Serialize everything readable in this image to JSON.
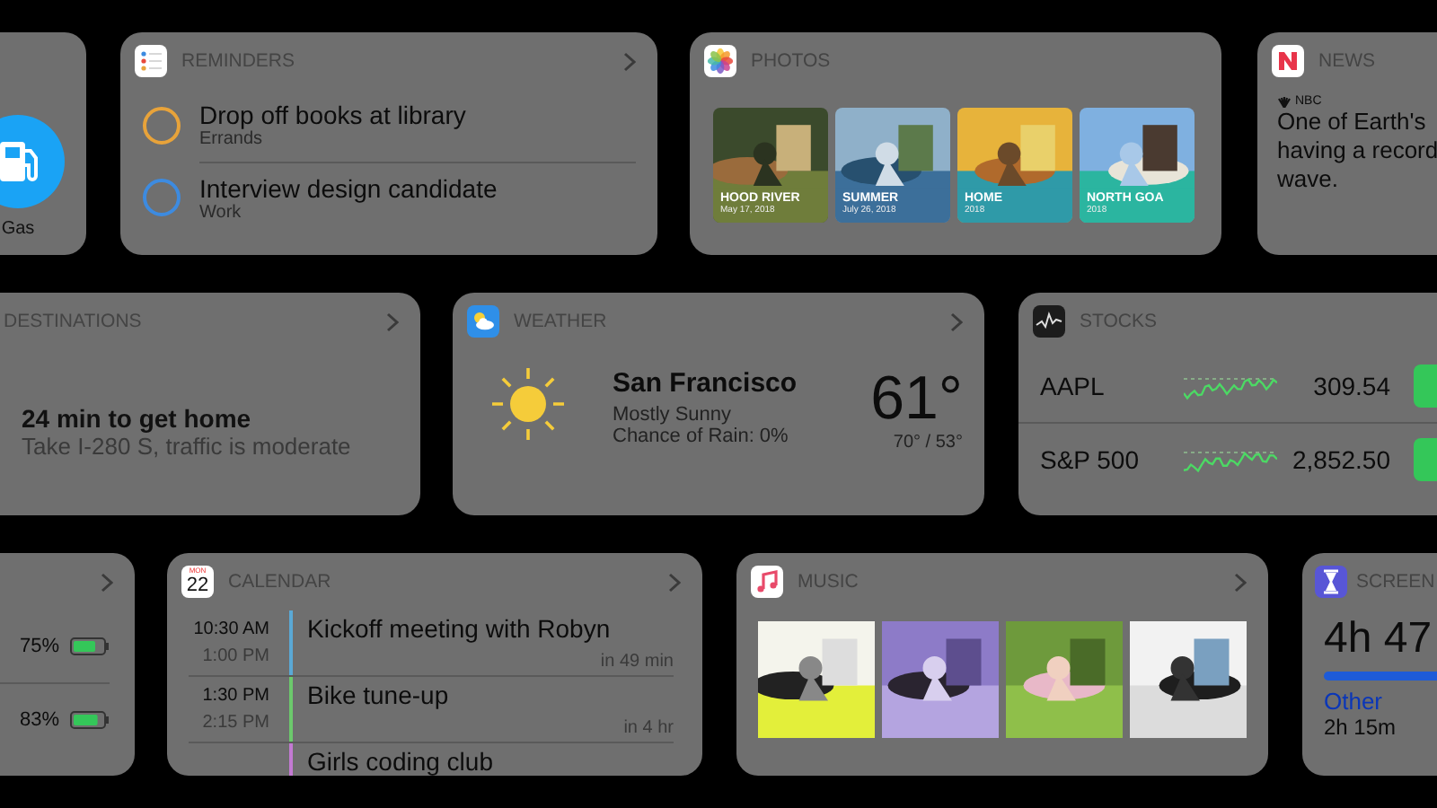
{
  "widget_rows": [
    [
      {
        "kind": "gas",
        "label": "Gas"
      },
      {
        "kind": "reminders",
        "title": "REMINDERS",
        "chevron": true,
        "items": [
          {
            "title": "Drop off books at library",
            "list": "Errands",
            "color": "#e8a33a"
          },
          {
            "title": "Interview design candidate",
            "list": "Work",
            "color": "#3d8be0"
          }
        ]
      },
      {
        "kind": "photos",
        "title": "PHOTOS",
        "chevron": false,
        "memories": [
          {
            "kind": "picture",
            "title": "HOOD RIVER",
            "date": "May 17, 2018"
          },
          {
            "kind": "picture",
            "title": "SUMMER",
            "date": "July 26, 2018"
          },
          {
            "kind": "picture",
            "title": "HOME",
            "date": "2018"
          },
          {
            "kind": "picture",
            "title": "NORTH GOA",
            "date": "2018"
          }
        ]
      },
      {
        "kind": "news",
        "title": "NEWS",
        "chevron": false,
        "source": "NBC",
        "headline_lines": [
          "One of Earth's",
          "having a record",
          "wave."
        ]
      }
    ],
    [
      {
        "kind": "destinations",
        "title": "DESTINATIONS",
        "chevron": true,
        "eta": "24 min to get home",
        "route": "Take I-280 S, traffic is moderate"
      },
      {
        "kind": "weather",
        "title": "WEATHER",
        "chevron": true,
        "city": "San Francisco",
        "condition": "Mostly Sunny",
        "rain": "Chance of Rain: 0%",
        "temp": "61°",
        "range": "70° / 53°"
      },
      {
        "kind": "stocks",
        "title": "STOCKS",
        "chevron": false,
        "quotes": [
          {
            "symbol": "AAPL",
            "price": "309.54"
          },
          {
            "symbol": "S&P 500",
            "price": "2,852.50"
          }
        ]
      }
    ],
    [
      {
        "kind": "batteries",
        "chevron": true,
        "devices": [
          {
            "percent": "75%",
            "level": 0.75
          },
          {
            "percent": "83%",
            "level": 0.83
          }
        ]
      },
      {
        "kind": "calendar",
        "title": "CALENDAR",
        "chevron": true,
        "icon_weekday": "MON",
        "icon_day": "22",
        "events": [
          {
            "start": "10:30 AM",
            "end": "1:00 PM",
            "title": "Kickoff meeting with Robyn",
            "until": "in 49 min",
            "color": "#5aa9d6"
          },
          {
            "start": "1:30 PM",
            "end": "2:15 PM",
            "title": "Bike tune-up",
            "until": "in 4 hr",
            "color": "#6cc96c"
          },
          {
            "title": "Girls coding club",
            "color": "#c37ad3"
          }
        ]
      },
      {
        "kind": "music",
        "title": "MUSIC",
        "chevron": true
      },
      {
        "kind": "screentime",
        "title": "SCREEN",
        "chevron": false,
        "total": "4h 47",
        "category": "Other",
        "category_time": "2h 15m"
      }
    ]
  ]
}
